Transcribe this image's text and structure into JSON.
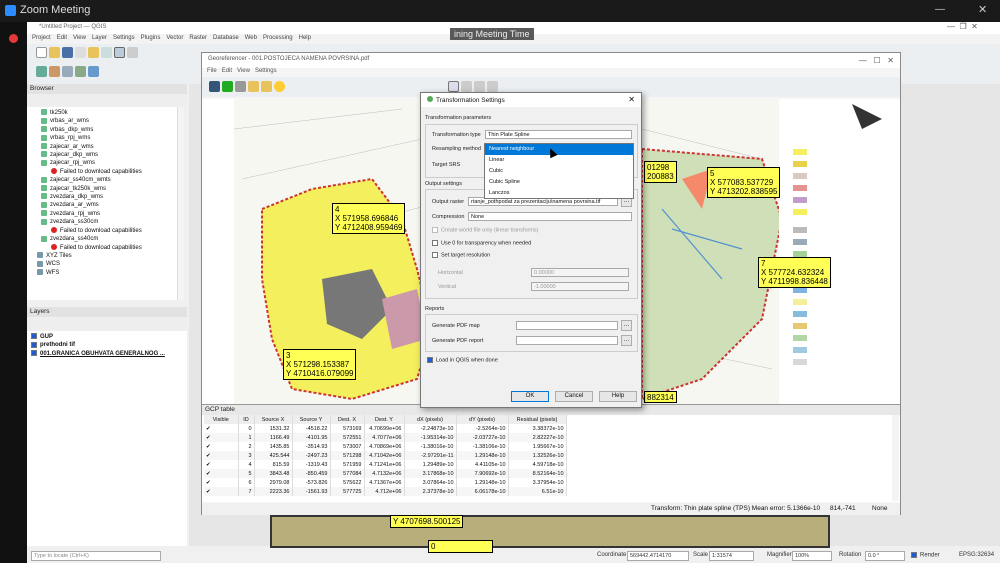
{
  "zoom": {
    "title": "Zoom Meeting",
    "banner": "ining Meeting Time"
  },
  "qgis": {
    "window_title": "*Untitled Project — QGIS",
    "menu": [
      "Project",
      "Edit",
      "View",
      "Layer",
      "Settings",
      "Plugins",
      "Vector",
      "Raster",
      "Database",
      "Web",
      "Processing",
      "Help"
    ],
    "browser_title": "Browser",
    "browser_items": [
      {
        "label": "tk250k",
        "type": "layer"
      },
      {
        "label": "vrbas_ar_wms",
        "type": "layer"
      },
      {
        "label": "vrbas_dkp_wms",
        "type": "layer"
      },
      {
        "label": "vrbas_rpj_wms",
        "type": "layer"
      },
      {
        "label": "zajecar_ar_wms",
        "type": "layer"
      },
      {
        "label": "zajecar_dkp_wms",
        "type": "layer"
      },
      {
        "label": "zajecar_rpj_wms",
        "type": "layer"
      },
      {
        "label": "Failed to download capabilities",
        "type": "error"
      },
      {
        "label": "zajecar_ss40cm_wmts",
        "type": "layer"
      },
      {
        "label": "zajecar_tk250k_wms",
        "type": "layer"
      },
      {
        "label": "zvezdara_dkp_wms",
        "type": "layer"
      },
      {
        "label": "zvezdara_ar_wms",
        "type": "layer"
      },
      {
        "label": "zvezdara_rpj_wms",
        "type": "layer"
      },
      {
        "label": "zvezdara_ss30cm",
        "type": "layer"
      },
      {
        "label": "Failed to download capabilities",
        "type": "error"
      },
      {
        "label": "zvezdara_ss40cm",
        "type": "layer"
      },
      {
        "label": "Failed to download capabilities",
        "type": "error"
      },
      {
        "label": "XYZ Tiles",
        "type": "group"
      },
      {
        "label": "WCS",
        "type": "group"
      },
      {
        "label": "WFS",
        "type": "group"
      }
    ],
    "layers_title": "Layers",
    "layers": [
      "GUP",
      "prethodni tif",
      "001.GRANICA OBUHVATA GENERALNOG ..."
    ],
    "locate_placeholder": "Type to locate (Ctrl+K)",
    "status": {
      "coordinate_label": "Coordinate",
      "coordinate": "569442,4714170",
      "scale_label": "Scale",
      "scale": "1:31574",
      "magnifier_label": "Magnifier",
      "magnifier": "100%",
      "rotation_label": "Rotation",
      "rotation": "0.0 °",
      "render": "Render",
      "epsg": "EPSG:32634"
    }
  },
  "georef": {
    "title": "Georeferencer - 001.POSTOJECA NAMENA POVRSINA.pdf",
    "menu": [
      "File",
      "Edit",
      "View",
      "Settings"
    ],
    "gcps": [
      {
        "id": "p4",
        "lines": [
          "4",
          "X 571958.696846",
          "Y 4712408.959469"
        ]
      },
      {
        "id": "p3",
        "lines": [
          "3",
          "X 571298.153387",
          "Y 4710416.079099"
        ]
      },
      {
        "id": "p5",
        "lines": [
          "5",
          "X 577083.537729",
          "Y 4713202.838595"
        ]
      },
      {
        "id": "p7",
        "lines": [
          "7",
          "X 577724.632324",
          "Y 4711998.836448"
        ]
      },
      {
        "id": "p1",
        "lines": [
          "01298",
          "200883"
        ]
      },
      {
        "id": "p6",
        "lines": [
          "882314"
        ]
      }
    ],
    "gcp_table_title": "GCP table",
    "gcp_columns": [
      "Visible",
      "ID",
      "Source X",
      "Source Y",
      "Dest. X",
      "Dest. Y",
      "dX (pixels)",
      "dY (pixels)",
      "Residual (pixels)"
    ],
    "gcp_rows": [
      [
        "0",
        "1531.32",
        "-4518.22",
        "573169",
        "4.70699e+06",
        "-2.24873e-10",
        "-2.5264e-10",
        "3.38372e-10"
      ],
      [
        "1",
        "1166.49",
        "-4101.95",
        "572551",
        "4.7077e+06",
        "-1.95314e-10",
        "-2.03727e-10",
        "2.82227e-10"
      ],
      [
        "2",
        "1435.85",
        "-3514.93",
        "573007",
        "4.70869e+06",
        "-1.38016e-10",
        "-1.38106e-10",
        "1.95667e-10"
      ],
      [
        "3",
        "425.544",
        "-2497.23",
        "571298",
        "4.71042e+06",
        "-2.97291e-11",
        "1.29148e-10",
        "1.32526e-10"
      ],
      [
        "4",
        "815.59",
        "-1319.43",
        "571959",
        "4.71241e+06",
        "1.29489e-10",
        "4.41105e-10",
        "4.59718e-10"
      ],
      [
        "5",
        "3843.48",
        "-850.459",
        "577084",
        "4.7132e+06",
        "3.17868e-10",
        "7.90692e-10",
        "8.52164e-10"
      ],
      [
        "6",
        "2979.08",
        "-573.826",
        "575622",
        "4.71367e+06",
        "3.07864e-10",
        "1.29148e-10",
        "3.37954e-10"
      ],
      [
        "7",
        "2223.36",
        "-1561.93",
        "577725",
        "4.712e+06",
        "2.37378e-10",
        "6.06178e-10",
        "6.51e-10"
      ]
    ],
    "status_text": "Transform: Thin plate spline (TPS) Mean error: 5.1366e-10",
    "status_coords": "814,-741",
    "status_none": "None",
    "below_label": "Y 4707698.500125",
    "below_id": "0"
  },
  "dialog": {
    "title": "Transformation Settings",
    "section_params": "Transformation parameters",
    "type_label": "Transformation type",
    "type_value": "Thin Plate Spline",
    "resampling_label": "Resampling method",
    "srs_label": "Target SRS",
    "options": [
      "Nearest neighbour",
      "Linear",
      "Cubic",
      "Cubic Spline",
      "Lanczos"
    ],
    "section_output": "Output settings",
    "output_raster_label": "Output raster",
    "output_raster_value": "rtanje_pothpodat za prezentaciju\\namena povrsina.tif",
    "compression_label": "Compression",
    "compression_value": "None",
    "world_file": "Create world file only (linear transforms)",
    "use0": "Use 0 for transparency when needed",
    "set_res": "Set target resolution",
    "horizontal_label": "Horizontal",
    "horizontal_value": "0.00000",
    "vertical_label": "Vertical",
    "vertical_value": "-1.00000",
    "section_reports": "Reports",
    "pdf_map_label": "Generate PDF map",
    "pdf_report_label": "Generate PDF report",
    "load_label": "Load in QGIS when done",
    "ok": "OK",
    "cancel": "Cancel",
    "help": "Help"
  }
}
